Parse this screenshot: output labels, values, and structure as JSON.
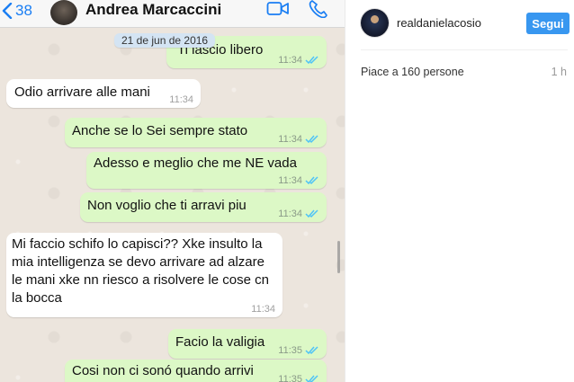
{
  "chat": {
    "back_count": "38",
    "contact_name": "Andrea Marcaccini",
    "date_chip": "21 de jun de 2016",
    "messages": [
      {
        "dir": "out",
        "text": "Ti lascio libero",
        "time": "11:34"
      },
      {
        "dir": "in",
        "text": "Odio arrivare alle mani",
        "time": "11:34"
      },
      {
        "dir": "out",
        "text": "Anche se lo Sei sempre stato",
        "time": "11:34"
      },
      {
        "dir": "out",
        "text": "Adesso e meglio che me NE vada",
        "time": "11:34"
      },
      {
        "dir": "out",
        "text": "Non voglio che ti arravi piu",
        "time": "11:34"
      },
      {
        "dir": "in",
        "text": "Mi faccio schifo lo capisci?? Xke insulto la mia intelligenza se devo arrivare ad alzare le mani xke nn riesco a risolvere le cose cn la bocca",
        "time": "11:34"
      },
      {
        "dir": "out",
        "text": "Facio la valigia",
        "time": "11:35"
      },
      {
        "dir": "out",
        "text": "Cosi non ci sonó quando arrivi",
        "time": "11:35"
      }
    ],
    "icons": {
      "back": "chevron-left-icon",
      "video": "video-call-icon",
      "phone": "phone-icon",
      "read": "double-check-icon"
    },
    "colors": {
      "accent": "#1a7ef3",
      "outgoing": "#dcf8c6",
      "incoming": "#ffffff",
      "read_ticks": "#4fc3f7"
    }
  },
  "instagram": {
    "username": "realdanielacosio",
    "follow_label": "Segui",
    "likes": "Piace a 160 persone",
    "time": "1 h",
    "colors": {
      "follow_button": "#3897f0"
    }
  }
}
